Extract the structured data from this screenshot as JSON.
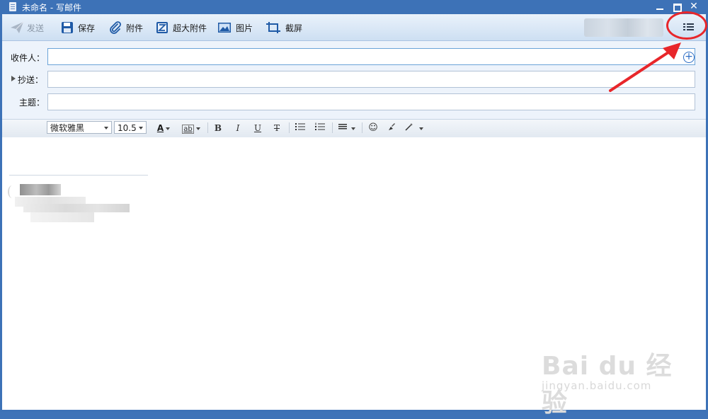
{
  "window": {
    "title": "未命名 - 写邮件"
  },
  "toolbar": {
    "send_label": "发送",
    "save_label": "保存",
    "attach_label": "附件",
    "large_attach_label": "超大附件",
    "image_label": "图片",
    "screenshot_label": "截屏",
    "menu_icon": "list-menu-icon"
  },
  "fields": {
    "to_label": "收件人：",
    "cc_label": "抄送：",
    "subject_label": "主题：",
    "to_value": "",
    "cc_value": "",
    "subject_value": ""
  },
  "format": {
    "font_family": "微软雅黑",
    "font_size": "10.5",
    "font_color_glyph": "A",
    "highlight_glyph": "ab",
    "bold": "B",
    "italic": "I",
    "underline": "U",
    "strike": "T"
  },
  "watermark": {
    "main": "Bai du 经验",
    "sub": "jingyan.baidu.com"
  },
  "colors": {
    "accent": "#3d72b7",
    "annotation": "#e8262a"
  }
}
